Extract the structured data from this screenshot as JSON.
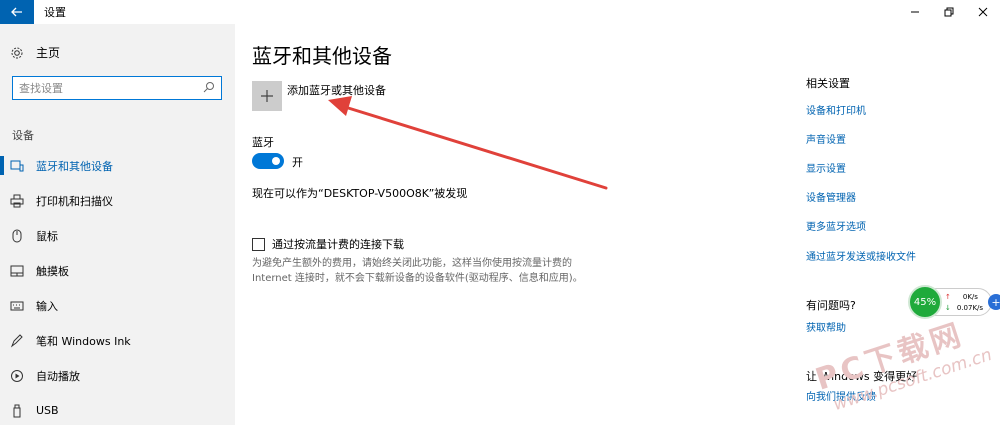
{
  "window": {
    "title": "设置"
  },
  "sidebar": {
    "home_label": "主页",
    "search_placeholder": "查找设置",
    "section": "设备",
    "items": [
      {
        "label": "蓝牙和其他设备",
        "icon": "bluetooth-devices-icon",
        "active": true
      },
      {
        "label": "打印机和扫描仪",
        "icon": "printer-icon"
      },
      {
        "label": "鼠标",
        "icon": "mouse-icon"
      },
      {
        "label": "触摸板",
        "icon": "touchpad-icon"
      },
      {
        "label": "输入",
        "icon": "keyboard-icon"
      },
      {
        "label": "笔和 Windows Ink",
        "icon": "pen-icon"
      },
      {
        "label": "自动播放",
        "icon": "autoplay-icon"
      },
      {
        "label": "USB",
        "icon": "usb-icon"
      }
    ]
  },
  "main": {
    "title": "蓝牙和其他设备",
    "add_label": "添加蓝牙或其他设备",
    "bluetooth_label": "蓝牙",
    "toggle_state": "开",
    "discoverable": "现在可以作为“DESKTOP-V500O8K”被发现",
    "metered_label": "通过按流量计费的连接下载",
    "metered_desc": "为避免产生额外的费用，请始终关闭此功能，这样当你使用按流量计费的 Internet 连接时，就不会下载新设备的设备软件(驱动程序、信息和应用)。"
  },
  "right": {
    "related_heading": "相关设置",
    "links": [
      "设备和打印机",
      "声音设置",
      "显示设置",
      "设备管理器",
      "更多蓝牙选项",
      "通过蓝牙发送或接收文件"
    ],
    "question_heading": "有问题吗?",
    "help_link": "获取帮助",
    "better_heading": "让 Windows 变得更好",
    "feedback_link": "向我们提供反馈"
  },
  "widget": {
    "percent": "45%",
    "up": "0K/s",
    "down": "0.07K/s"
  },
  "watermark": {
    "logo": "PC下载网",
    "url": "www.pcsoft.com.cn"
  },
  "colors": {
    "accent": "#0063b1",
    "toggle": "#0078d7",
    "annotation": "#e0413a"
  }
}
